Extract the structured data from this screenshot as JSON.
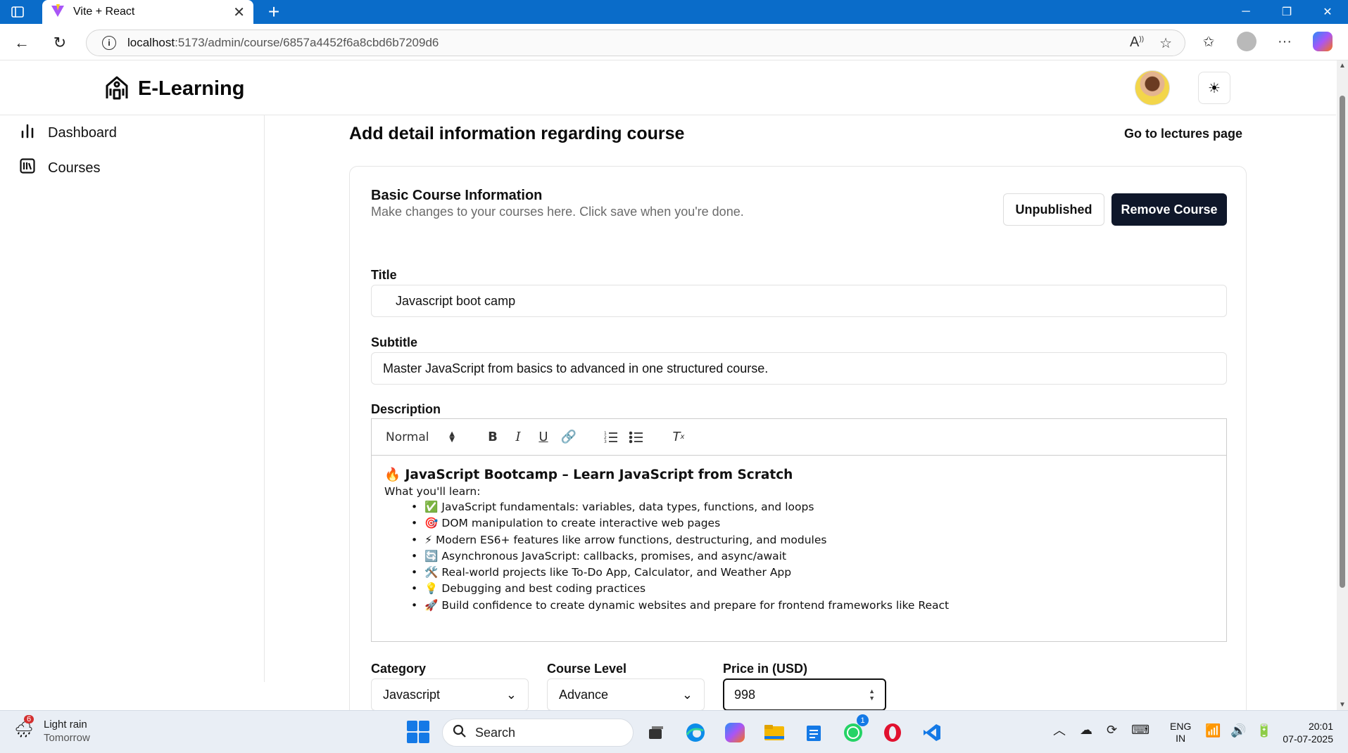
{
  "browser": {
    "tab_title": "Vite + React",
    "url_host": "localhost",
    "url_path": ":5173/admin/course/6857a4452f6a8cbd6b7209d6"
  },
  "app": {
    "logo_text": "E-Learning"
  },
  "sidebar": {
    "items": [
      {
        "label": "Dashboard",
        "icon": "bar-chart-icon"
      },
      {
        "label": "Courses",
        "icon": "library-icon"
      }
    ]
  },
  "main": {
    "title": "Add detail information regarding course",
    "lectures_link": "Go to lectures page"
  },
  "card": {
    "title": "Basic Course Information",
    "description": "Make changes to your courses here. Click save when you're done.",
    "unpublish_label": "Unpublished",
    "remove_label": "Remove Course"
  },
  "form": {
    "title_label": "Title",
    "title_value": "Javascript boot camp",
    "subtitle_label": "Subtitle",
    "subtitle_value": "Master JavaScript from basics to advanced in one structured course.",
    "description_label": "Description",
    "editor": {
      "format": "Normal",
      "heading": "🔥 JavaScript Bootcamp – Learn JavaScript from Scratch",
      "subheading": "What you'll learn:",
      "items": [
        "✅ JavaScript fundamentals: variables, data types, functions, and loops",
        "🎯 DOM manipulation to create interactive web pages",
        "⚡ Modern ES6+ features like arrow functions, destructuring, and modules",
        "🔄 Asynchronous JavaScript: callbacks, promises, and async/await",
        "🛠️ Real-world projects like To-Do App, Calculator, and Weather App",
        "💡 Debugging and best coding practices",
        "🚀 Build confidence to create dynamic websites and prepare for frontend frameworks like React"
      ]
    },
    "category_label": "Category",
    "category_value": "Javascript",
    "level_label": "Course Level",
    "level_value": "Advance",
    "price_label": "Price in (USD)",
    "price_value": "998"
  },
  "taskbar": {
    "weather_badge": "6",
    "weather_title": "Light rain",
    "weather_sub": "Tomorrow",
    "search_label": "Search",
    "whatsapp_badge": "1",
    "lang_top": "ENG",
    "lang_bottom": "IN",
    "time": "20:01",
    "date": "07-07-2025"
  }
}
